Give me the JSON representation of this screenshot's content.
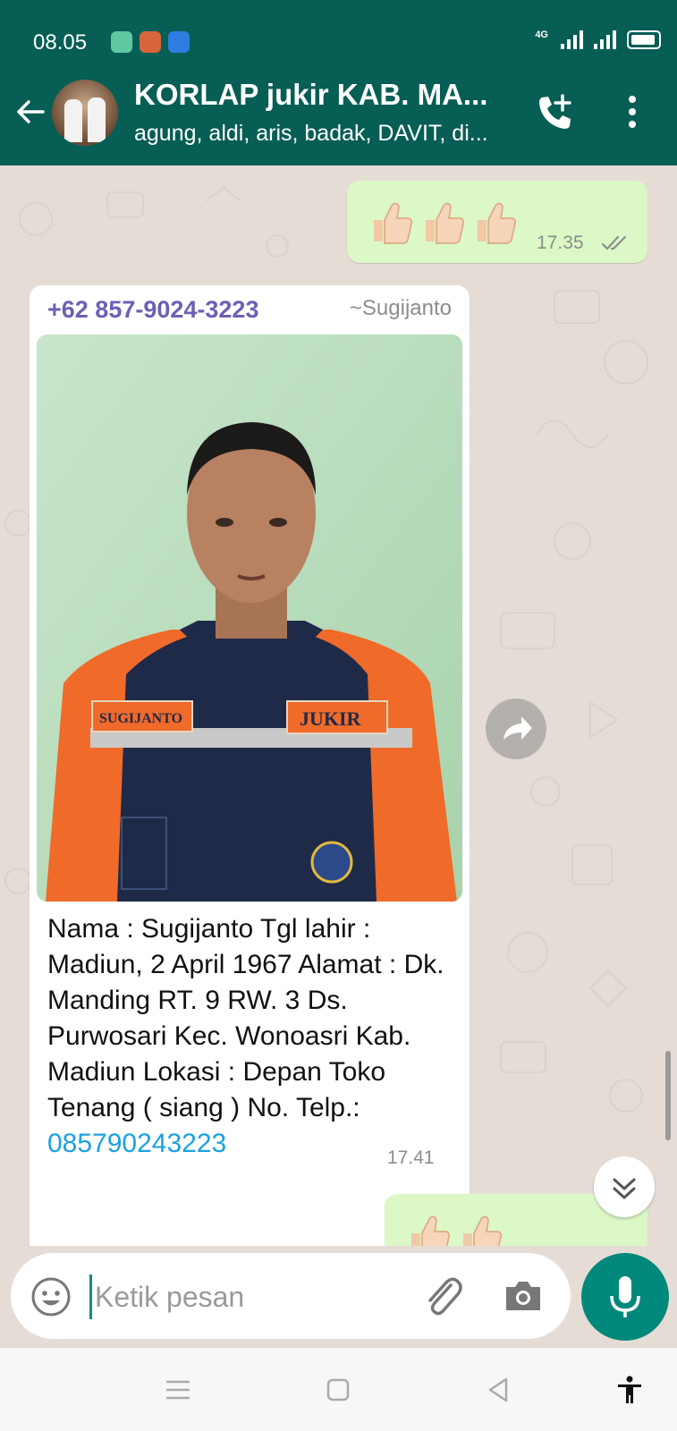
{
  "status_bar": {
    "time": "08.05",
    "network": "4G",
    "app_icon_colors": [
      "#5ec8a0",
      "#d9653c",
      "#2f7de1"
    ]
  },
  "header": {
    "title": "KORLAP jukir KAB. MA...",
    "subtitle": "agung, aldi, aris, badak, DAVIT, di..."
  },
  "messages": [
    {
      "type": "outgoing",
      "content": "👍👍👍",
      "time": "17.35",
      "status": "read"
    },
    {
      "type": "incoming",
      "sender_phone": "+62 857-9024-3223",
      "sender_name": "~Sugijanto",
      "image": "photo of man in orange jukir uniform",
      "caption": "Nama : Sugijanto Tgl lahir : Madiun, 2 April 1967 Alamat : Dk. Manding RT. 9 RW. 3 Ds. Purwosari Kec. Wonoasri Kab. Madiun Lokasi : Depan Toko Tenang ( siang ) No. Telp.: ",
      "caption_link": "085790243223",
      "time": "17.41"
    },
    {
      "type": "outgoing",
      "content": "👍👍"
    }
  ],
  "input": {
    "placeholder": "Ketik pesan",
    "value": ""
  },
  "colors": {
    "header": "#075e54",
    "outgoing_bubble": "#dcf8c6",
    "incoming_bubble": "#ffffff",
    "accent": "#00897b",
    "link": "#1aa1e0",
    "sender": "#6e5fb5"
  }
}
